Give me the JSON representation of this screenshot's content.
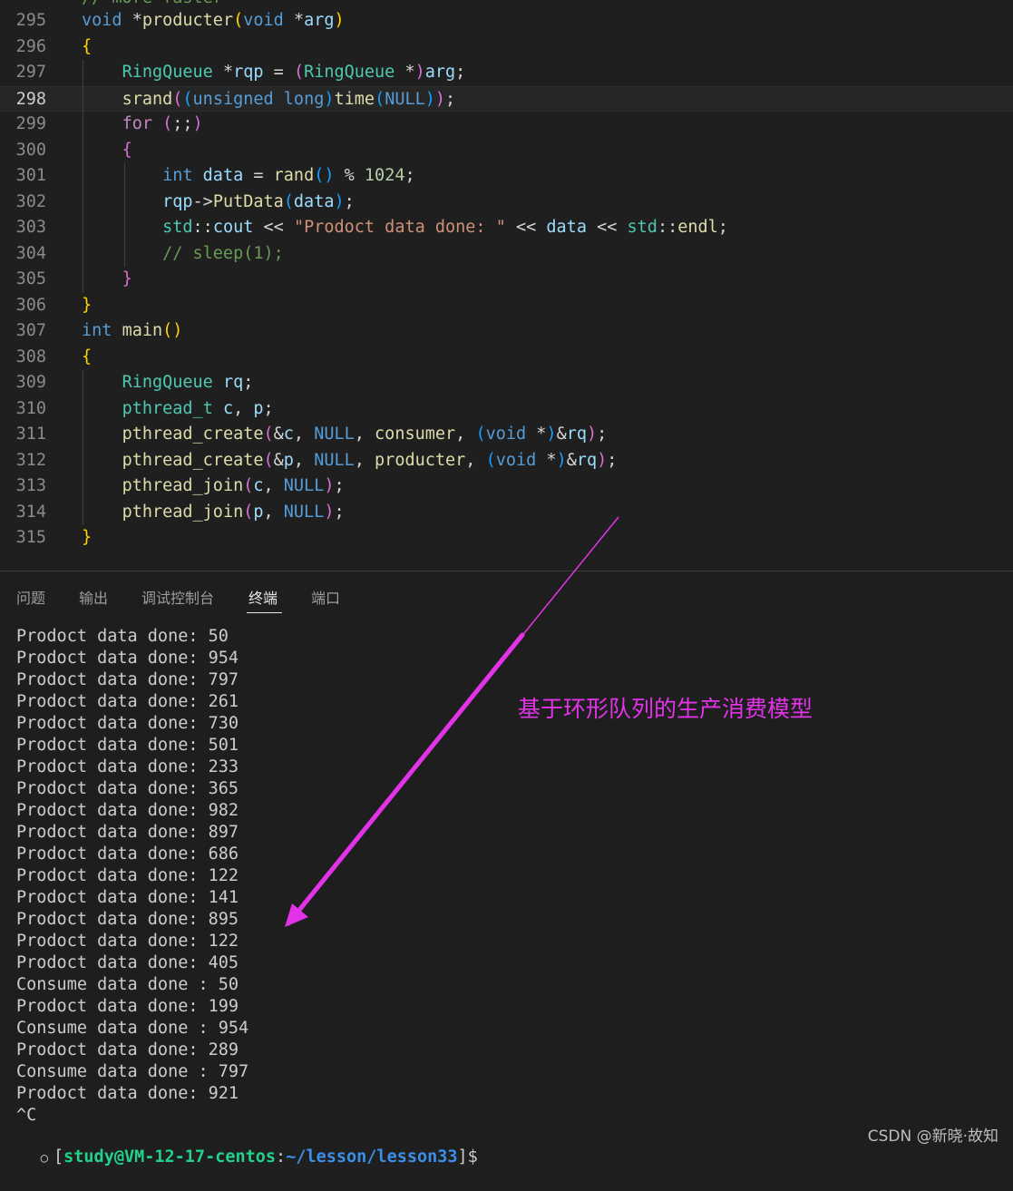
{
  "editor": {
    "partial_top": "// more faster",
    "lines": [
      {
        "n": "295",
        "tokens": [
          [
            "void",
            "kw"
          ],
          [
            " ",
            "op"
          ],
          [
            "*",
            "op"
          ],
          [
            "producter",
            "fn"
          ],
          [
            "(",
            "b1"
          ],
          [
            "void",
            "kw"
          ],
          [
            " ",
            "op"
          ],
          [
            "*",
            "op"
          ],
          [
            "arg",
            "var"
          ],
          [
            ")",
            "b1"
          ]
        ]
      },
      {
        "n": "296",
        "tokens": [
          [
            "{",
            "b1"
          ]
        ]
      },
      {
        "n": "297",
        "tokens": [
          [
            "    ",
            "op"
          ],
          [
            "RingQueue",
            "ty"
          ],
          [
            " *",
            "op"
          ],
          [
            "rqp",
            "var"
          ],
          [
            " = ",
            "op"
          ],
          [
            "(",
            "b2"
          ],
          [
            "RingQueue",
            "ty"
          ],
          [
            " *",
            "op"
          ],
          [
            ")",
            "b2"
          ],
          [
            "arg",
            "var"
          ],
          [
            ";",
            "op"
          ]
        ]
      },
      {
        "n": "298",
        "tokens": [
          [
            "    ",
            "op"
          ],
          [
            "srand",
            "fn"
          ],
          [
            "(",
            "b2"
          ],
          [
            "(",
            "b3"
          ],
          [
            "unsigned",
            "kw"
          ],
          [
            " ",
            "op"
          ],
          [
            "long",
            "kw"
          ],
          [
            ")",
            "b3"
          ],
          [
            "time",
            "fn"
          ],
          [
            "(",
            "b3"
          ],
          [
            "NULL",
            "kw"
          ],
          [
            ")",
            "b3"
          ],
          [
            ")",
            "b2"
          ],
          [
            ";",
            "op"
          ]
        ]
      },
      {
        "n": "299",
        "tokens": [
          [
            "    ",
            "op"
          ],
          [
            "for",
            "ctl"
          ],
          [
            " ",
            "op"
          ],
          [
            "(",
            "b2"
          ],
          [
            ";;",
            "op"
          ],
          [
            ")",
            "b2"
          ]
        ]
      },
      {
        "n": "300",
        "tokens": [
          [
            "    ",
            "op"
          ],
          [
            "{",
            "b2"
          ]
        ]
      },
      {
        "n": "301",
        "tokens": [
          [
            "        ",
            "op"
          ],
          [
            "int",
            "kw"
          ],
          [
            " ",
            "op"
          ],
          [
            "data",
            "var"
          ],
          [
            " = ",
            "op"
          ],
          [
            "rand",
            "fn"
          ],
          [
            "(",
            "b3"
          ],
          [
            ")",
            "b3"
          ],
          [
            " % ",
            "op"
          ],
          [
            "1024",
            "num"
          ],
          [
            ";",
            "op"
          ]
        ]
      },
      {
        "n": "302",
        "tokens": [
          [
            "        ",
            "op"
          ],
          [
            "rqp",
            "var"
          ],
          [
            "->",
            "op"
          ],
          [
            "PutData",
            "fn"
          ],
          [
            "(",
            "b3"
          ],
          [
            "data",
            "var"
          ],
          [
            ")",
            "b3"
          ],
          [
            ";",
            "op"
          ]
        ]
      },
      {
        "n": "303",
        "tokens": [
          [
            "        ",
            "op"
          ],
          [
            "std",
            "ty"
          ],
          [
            "::",
            "op"
          ],
          [
            "cout",
            "var"
          ],
          [
            " << ",
            "op"
          ],
          [
            "\"Prodoct data done: \"",
            "str"
          ],
          [
            " << ",
            "op"
          ],
          [
            "data",
            "var"
          ],
          [
            " << ",
            "op"
          ],
          [
            "std",
            "ty"
          ],
          [
            "::",
            "op"
          ],
          [
            "endl",
            "fn"
          ],
          [
            ";",
            "op"
          ]
        ]
      },
      {
        "n": "304",
        "tokens": [
          [
            "        ",
            "op"
          ],
          [
            "// sleep(1);",
            "cm"
          ]
        ]
      },
      {
        "n": "305",
        "tokens": [
          [
            "    ",
            "op"
          ],
          [
            "}",
            "b2"
          ]
        ]
      },
      {
        "n": "306",
        "tokens": [
          [
            "}",
            "b1"
          ]
        ]
      },
      {
        "n": "307",
        "tokens": [
          [
            "int",
            "kw"
          ],
          [
            " ",
            "op"
          ],
          [
            "main",
            "fn"
          ],
          [
            "(",
            "b1"
          ],
          [
            ")",
            "b1"
          ]
        ]
      },
      {
        "n": "308",
        "tokens": [
          [
            "{",
            "b1"
          ]
        ]
      },
      {
        "n": "309",
        "tokens": [
          [
            "    ",
            "op"
          ],
          [
            "RingQueue",
            "ty"
          ],
          [
            " ",
            "op"
          ],
          [
            "rq",
            "var"
          ],
          [
            ";",
            "op"
          ]
        ]
      },
      {
        "n": "310",
        "tokens": [
          [
            "    ",
            "op"
          ],
          [
            "pthread_t",
            "ty"
          ],
          [
            " ",
            "op"
          ],
          [
            "c",
            "var"
          ],
          [
            ", ",
            "op"
          ],
          [
            "p",
            "var"
          ],
          [
            ";",
            "op"
          ]
        ]
      },
      {
        "n": "311",
        "tokens": [
          [
            "    ",
            "op"
          ],
          [
            "pthread_create",
            "fn"
          ],
          [
            "(",
            "b2"
          ],
          [
            "&",
            "op"
          ],
          [
            "c",
            "var"
          ],
          [
            ", ",
            "op"
          ],
          [
            "NULL",
            "kw"
          ],
          [
            ", ",
            "op"
          ],
          [
            "consumer",
            "fn"
          ],
          [
            ", ",
            "op"
          ],
          [
            "(",
            "b3"
          ],
          [
            "void",
            "kw"
          ],
          [
            " *",
            "op"
          ],
          [
            ")",
            "b3"
          ],
          [
            "&",
            "op"
          ],
          [
            "rq",
            "var"
          ],
          [
            ")",
            "b2"
          ],
          [
            ";",
            "op"
          ]
        ]
      },
      {
        "n": "312",
        "tokens": [
          [
            "    ",
            "op"
          ],
          [
            "pthread_create",
            "fn"
          ],
          [
            "(",
            "b2"
          ],
          [
            "&",
            "op"
          ],
          [
            "p",
            "var"
          ],
          [
            ", ",
            "op"
          ],
          [
            "NULL",
            "kw"
          ],
          [
            ", ",
            "op"
          ],
          [
            "producter",
            "fn"
          ],
          [
            ", ",
            "op"
          ],
          [
            "(",
            "b3"
          ],
          [
            "void",
            "kw"
          ],
          [
            " *",
            "op"
          ],
          [
            ")",
            "b3"
          ],
          [
            "&",
            "op"
          ],
          [
            "rq",
            "var"
          ],
          [
            ")",
            "b2"
          ],
          [
            ";",
            "op"
          ]
        ]
      },
      {
        "n": "313",
        "tokens": [
          [
            "    ",
            "op"
          ],
          [
            "pthread_join",
            "fn"
          ],
          [
            "(",
            "b2"
          ],
          [
            "c",
            "var"
          ],
          [
            ", ",
            "op"
          ],
          [
            "NULL",
            "kw"
          ],
          [
            ")",
            "b2"
          ],
          [
            ";",
            "op"
          ]
        ]
      },
      {
        "n": "314",
        "tokens": [
          [
            "    ",
            "op"
          ],
          [
            "pthread_join",
            "fn"
          ],
          [
            "(",
            "b2"
          ],
          [
            "p",
            "var"
          ],
          [
            ", ",
            "op"
          ],
          [
            "NULL",
            "kw"
          ],
          [
            ")",
            "b2"
          ],
          [
            ";",
            "op"
          ]
        ]
      },
      {
        "n": "315",
        "tokens": [
          [
            "}",
            "b1"
          ]
        ]
      }
    ],
    "current_line": "298"
  },
  "panel": {
    "tabs": [
      {
        "label": "问题"
      },
      {
        "label": "输出"
      },
      {
        "label": "调试控制台"
      },
      {
        "label": "终端"
      },
      {
        "label": "端口"
      }
    ],
    "active_tab": "终端"
  },
  "terminal": {
    "output": [
      "Prodoct data done: 50",
      "Prodoct data done: 954",
      "Prodoct data done: 797",
      "Prodoct data done: 261",
      "Prodoct data done: 730",
      "Prodoct data done: 501",
      "Prodoct data done: 233",
      "Prodoct data done: 365",
      "Prodoct data done: 982",
      "Prodoct data done: 897",
      "Prodoct data done: 686",
      "Prodoct data done: 122",
      "Prodoct data done: 141",
      "Prodoct data done: 895",
      "Prodoct data done: 122",
      "Prodoct data done: 405",
      "Consume data done : 50",
      "Prodoct data done: 199",
      "Consume data done : 954",
      "Prodoct data done: 289",
      "Consume data done : 797",
      "Prodoct data done: 921",
      "^C"
    ],
    "prompt": {
      "circle": "○",
      "open": "[",
      "user_host": "study@VM-12-17-centos",
      "sep": ":",
      "path": "~/lesson/lesson33",
      "close": "]$"
    }
  },
  "annotation": {
    "text": "基于环形队列的生产消费模型",
    "color": "#e333e8"
  },
  "watermark": "CSDN @新晓·故知"
}
